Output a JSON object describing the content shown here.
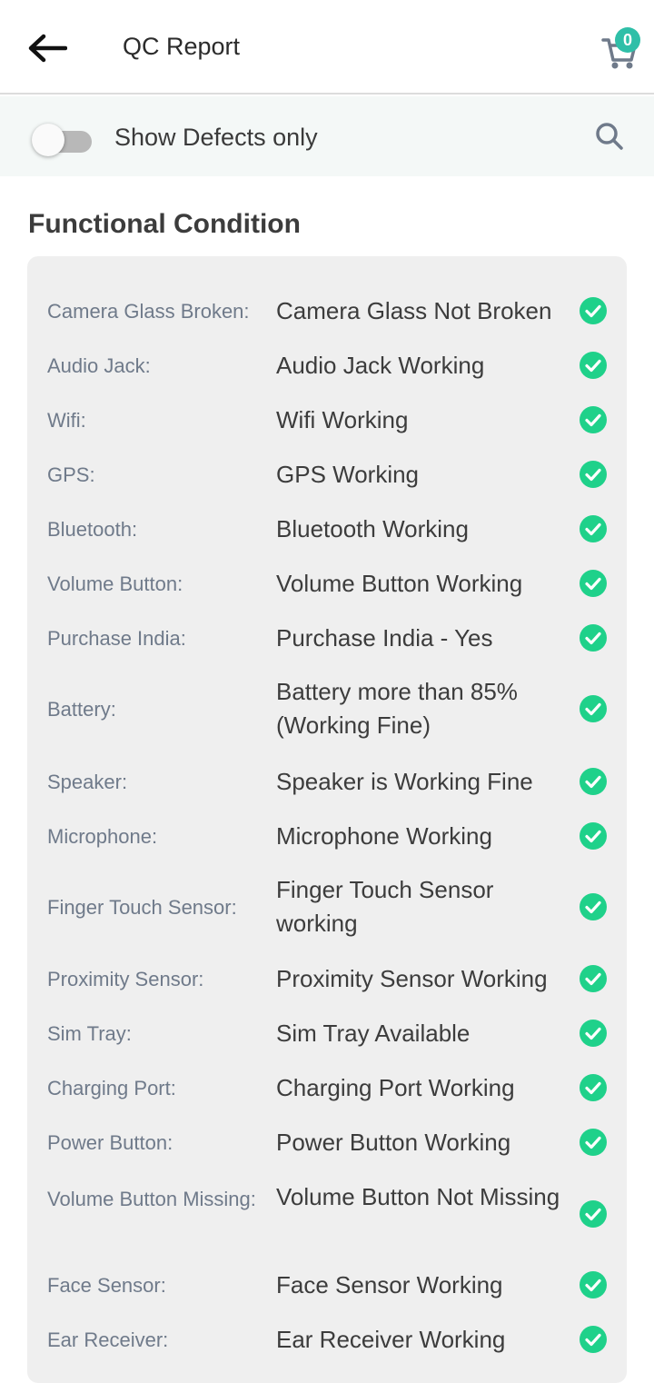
{
  "header": {
    "title": "QC Report",
    "cart_count": "0"
  },
  "filter": {
    "label": "Show Defects only",
    "enabled": false
  },
  "section": {
    "title": "Functional Condition"
  },
  "colors": {
    "accent": "#2fbfa8",
    "check": "#1fd18a"
  },
  "items": [
    {
      "label": "Camera Glass Broken:",
      "value": "Camera Glass Not Broken"
    },
    {
      "label": "Audio Jack:",
      "value": "Audio Jack Working"
    },
    {
      "label": "Wifi:",
      "value": "Wifi Working"
    },
    {
      "label": "GPS:",
      "value": "GPS Working"
    },
    {
      "label": "Bluetooth:",
      "value": "Bluetooth Working"
    },
    {
      "label": "Volume Button:",
      "value": "Volume Button Working"
    },
    {
      "label": "Purchase India:",
      "value": "Purchase India - Yes"
    },
    {
      "label": "Battery:",
      "value": "Battery more than 85% (Working Fine)"
    },
    {
      "label": "Speaker:",
      "value": "Speaker is Working Fine"
    },
    {
      "label": "Microphone:",
      "value": "Microphone Working"
    },
    {
      "label": "Finger Touch Sensor:",
      "value": "Finger Touch Sensor working"
    },
    {
      "label": "Proximity Sensor:",
      "value": "Proximity Sensor Working"
    },
    {
      "label": "Sim Tray:",
      "value": "Sim Tray Available"
    },
    {
      "label": "Charging Port:",
      "value": "Charging Port Working"
    },
    {
      "label": "Power Button:",
      "value": "Power Button Working"
    },
    {
      "label": "Volume Button Missing:",
      "value": "Volume Button Not Missing"
    },
    {
      "label": "Face Sensor:",
      "value": "Face Sensor Working"
    },
    {
      "label": "Ear Receiver:",
      "value": "Ear Receiver Working"
    }
  ]
}
